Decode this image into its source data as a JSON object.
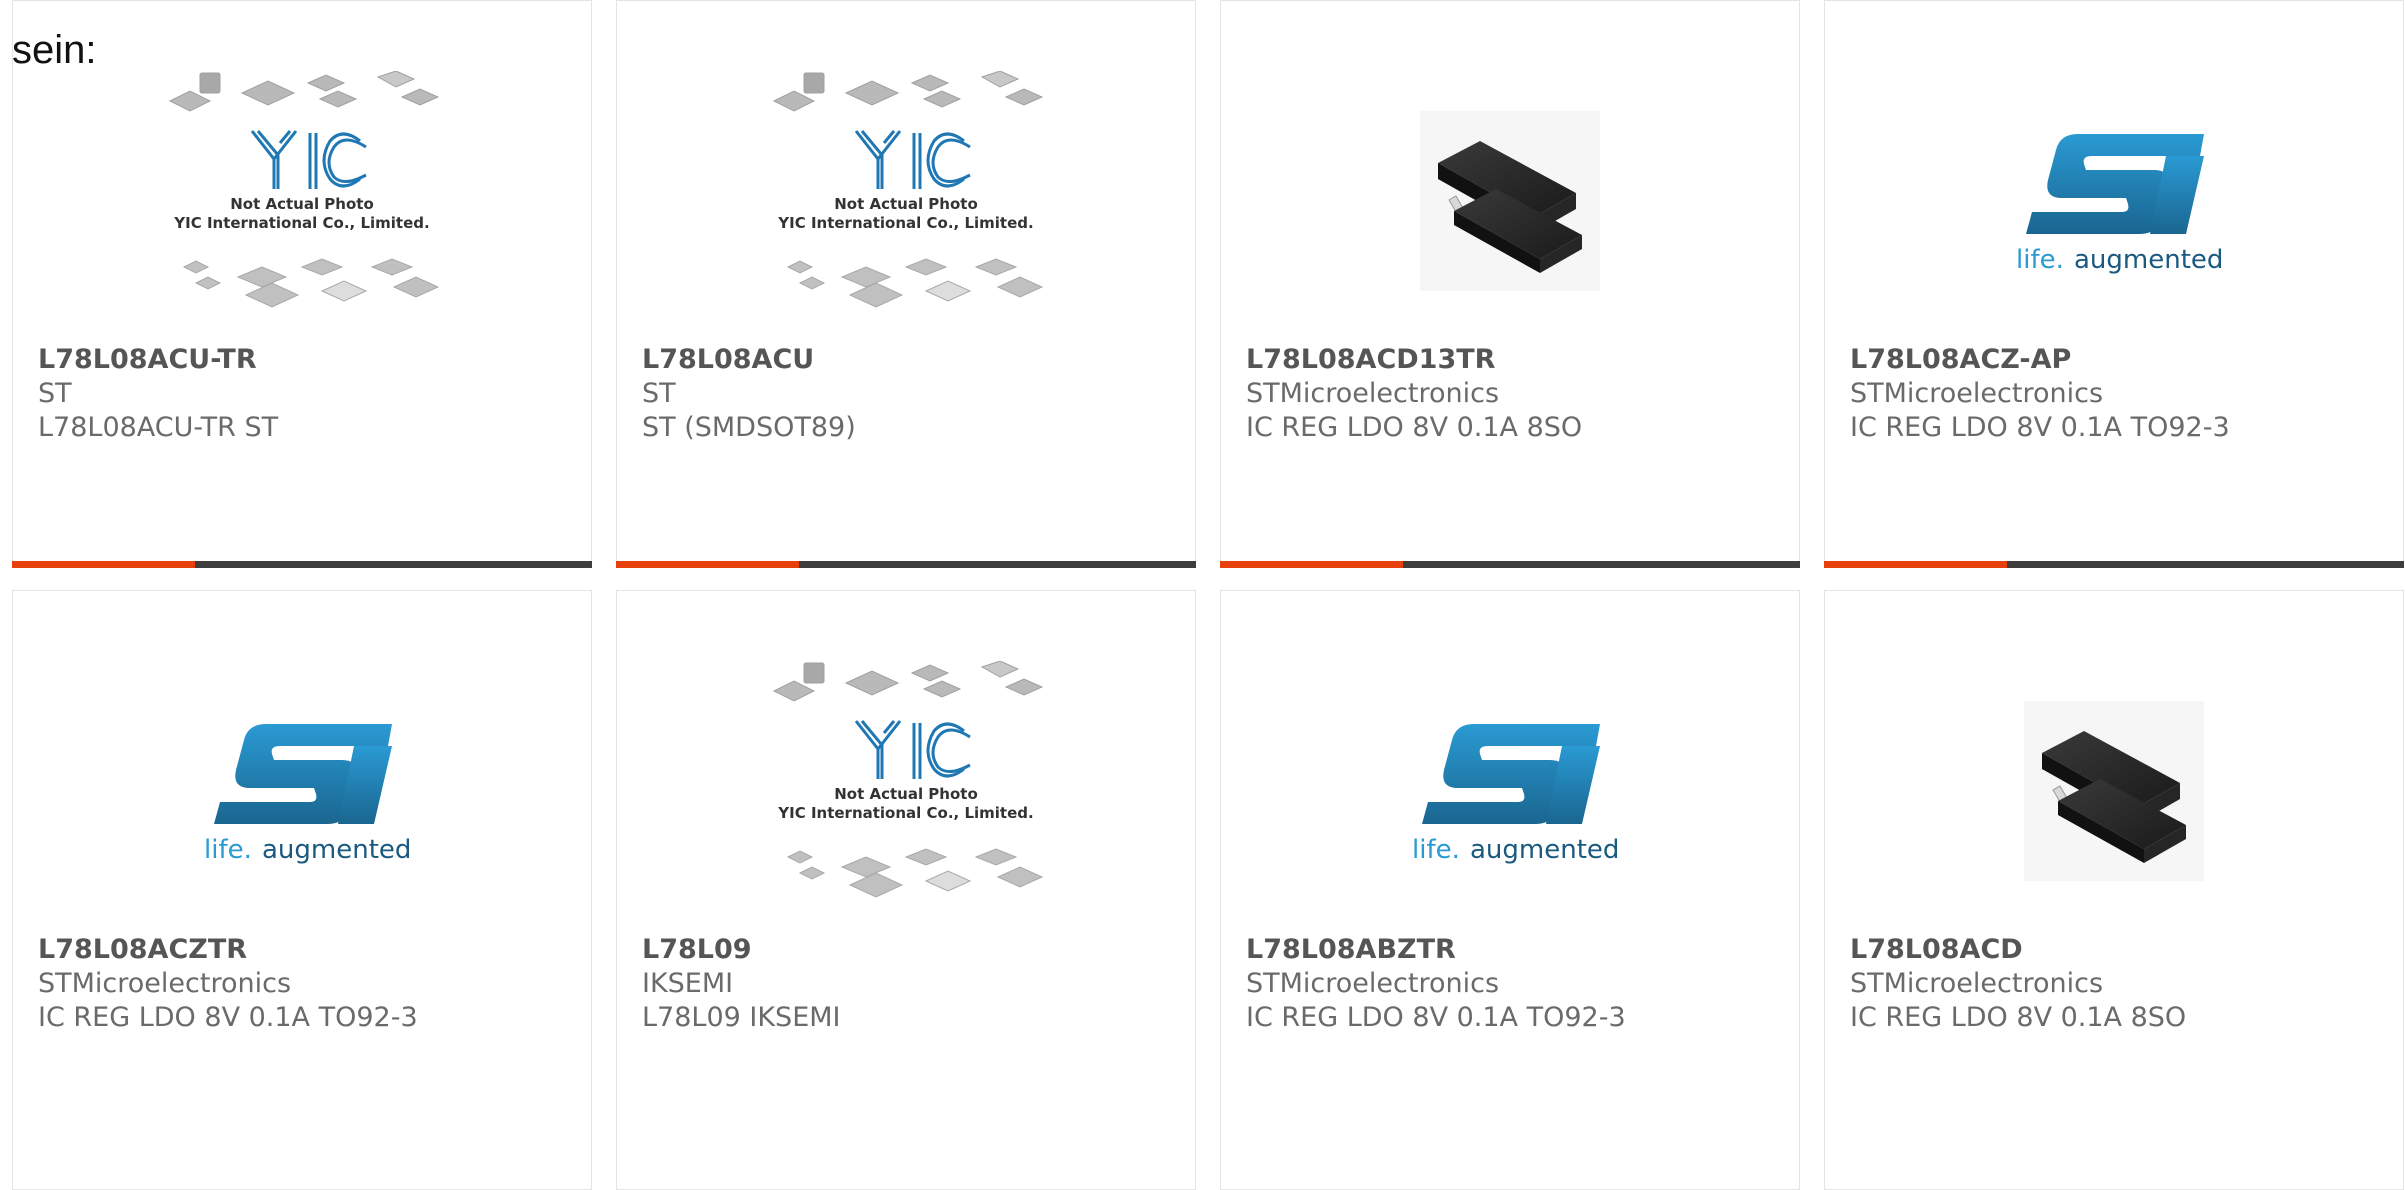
{
  "intro_text": "sein:",
  "placeholder": {
    "line1": "Not Actual Photo",
    "line2": "YIC International Co., Limited.",
    "logo": "YIC"
  },
  "st_logo": {
    "tagline_a": "life.",
    "tagline_b": "augmented"
  },
  "colors": {
    "accent": "#e8400b",
    "bar": "#3d3d3d",
    "st_blue": "#1f80b8"
  },
  "products": [
    {
      "part": "L78L08ACU-TR",
      "maker": "ST",
      "desc": "L78L08ACU-TR ST",
      "image": "not-actual-photo"
    },
    {
      "part": "L78L08ACU",
      "maker": "ST",
      "desc": "ST (SMDSOT89)",
      "image": "not-actual-photo"
    },
    {
      "part": "L78L08ACD13TR",
      "maker": "STMicroelectronics",
      "desc": "IC REG LDO 8V 0.1A 8SO",
      "image": "so8-chip"
    },
    {
      "part": "L78L08ACZ-AP",
      "maker": "STMicroelectronics",
      "desc": "IC REG LDO 8V 0.1A TO92-3",
      "image": "st-logo"
    },
    {
      "part": "L78L08ACZTR",
      "maker": "STMicroelectronics",
      "desc": "IC REG LDO 8V 0.1A TO92-3",
      "image": "st-logo"
    },
    {
      "part": "L78L09",
      "maker": "IKSEMI",
      "desc": "L78L09 IKSEMI",
      "image": "not-actual-photo"
    },
    {
      "part": "L78L08ABZTR",
      "maker": "STMicroelectronics",
      "desc": "IC REG LDO 8V 0.1A TO92-3",
      "image": "st-logo"
    },
    {
      "part": "L78L08ACD",
      "maker": "STMicroelectronics",
      "desc": "IC REG LDO 8V 0.1A 8SO",
      "image": "so8-chip"
    }
  ]
}
